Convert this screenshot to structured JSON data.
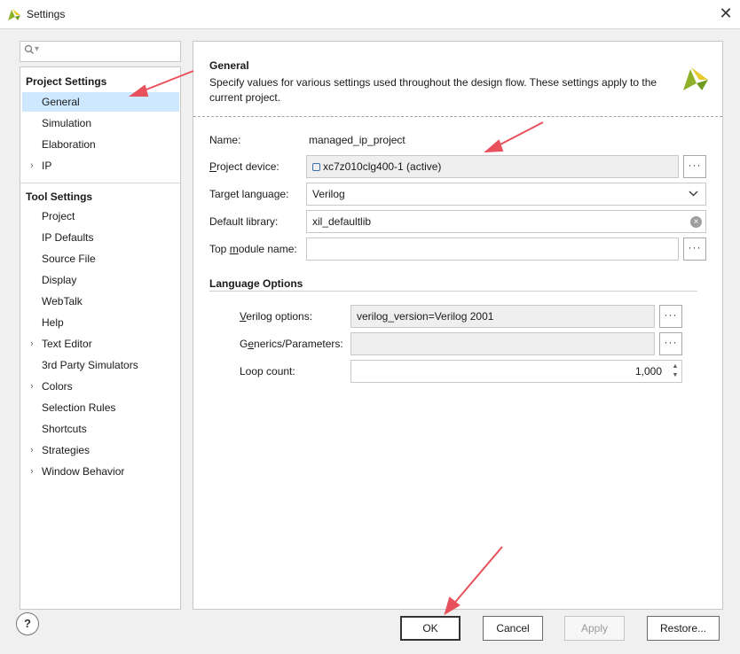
{
  "window": {
    "title": "Settings",
    "close_glyph": "✕"
  },
  "search": {
    "placeholder": ""
  },
  "tree": {
    "project_settings": {
      "header": "Project Settings",
      "items": [
        {
          "label": "General",
          "selected": true,
          "expandable": false
        },
        {
          "label": "Simulation",
          "selected": false,
          "expandable": false
        },
        {
          "label": "Elaboration",
          "selected": false,
          "expandable": false
        },
        {
          "label": "IP",
          "selected": false,
          "expandable": true
        }
      ]
    },
    "tool_settings": {
      "header": "Tool Settings",
      "items": [
        {
          "label": "Project",
          "expandable": false
        },
        {
          "label": "IP Defaults",
          "expandable": false
        },
        {
          "label": "Source File",
          "expandable": false
        },
        {
          "label": "Display",
          "expandable": false
        },
        {
          "label": "WebTalk",
          "expandable": false
        },
        {
          "label": "Help",
          "expandable": false
        },
        {
          "label": "Text Editor",
          "expandable": true
        },
        {
          "label": "3rd Party Simulators",
          "expandable": false
        },
        {
          "label": "Colors",
          "expandable": true
        },
        {
          "label": "Selection Rules",
          "expandable": false
        },
        {
          "label": "Shortcuts",
          "expandable": false
        },
        {
          "label": "Strategies",
          "expandable": true
        },
        {
          "label": "Window Behavior",
          "expandable": true
        }
      ]
    }
  },
  "general": {
    "title": "General",
    "description": "Specify values for various settings used throughout the design flow. These settings apply to the current project.",
    "name_label": "Name:",
    "name_value": "managed_ip_project",
    "device_label_u": "P",
    "device_label_rest": "roject device:",
    "device_value": "xc7z010clg400-1 (active)",
    "language_label": "Target language:",
    "language_value": "Verilog",
    "library_label": "Default library:",
    "library_value": "xil_defaultlib",
    "top_label_a": "Top ",
    "top_label_u": "m",
    "top_label_b": "odule name:",
    "top_value": ""
  },
  "language_options": {
    "header": "Language Options",
    "verilog_label_u": "V",
    "verilog_label_rest": "erilog options:",
    "verilog_value": "verilog_version=Verilog 2001",
    "generics_label_a": "G",
    "generics_label_u": "e",
    "generics_label_b": "nerics/Parameters:",
    "generics_value": "",
    "loop_label": "Loop count:",
    "loop_value": "1,000"
  },
  "buttons": {
    "ellipsis": "···",
    "help": "?",
    "ok": "OK",
    "cancel": "Cancel",
    "apply": "Apply",
    "restore": "Restore..."
  },
  "colors": {
    "selection": "#cde8ff",
    "annotation_arrow": "#e8505b",
    "logo_green": "#8db12b",
    "logo_yellow": "#e8c92e"
  }
}
